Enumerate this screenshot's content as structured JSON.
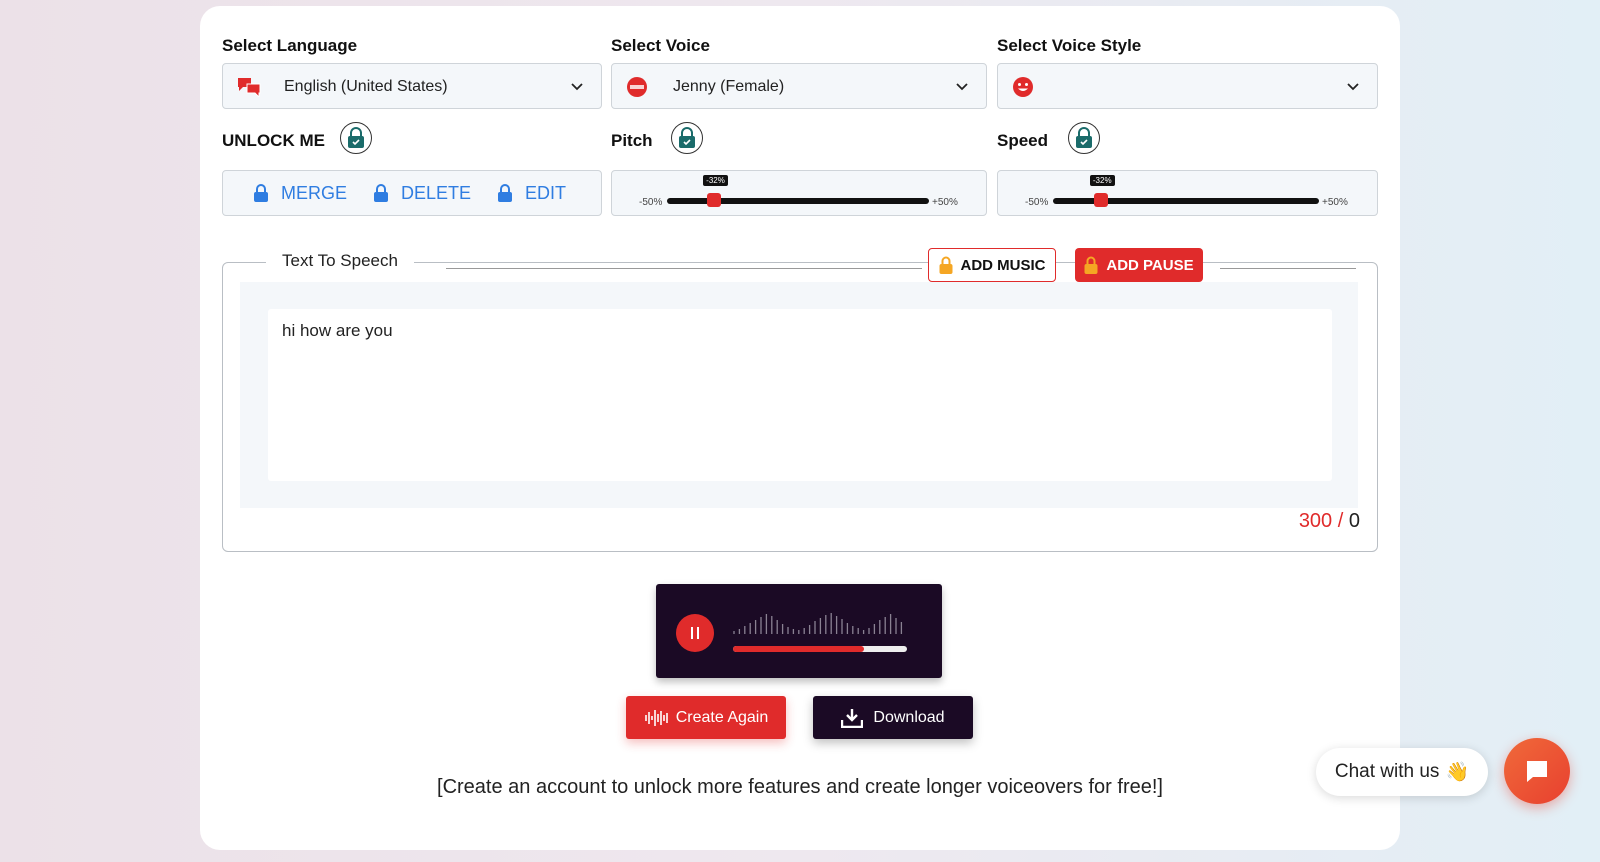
{
  "language": {
    "label": "Select Language",
    "value": "English (United States)"
  },
  "voice": {
    "label": "Select Voice",
    "value": "Jenny (Female)"
  },
  "voice_style": {
    "label": "Select Voice Style",
    "value": ""
  },
  "unlock": {
    "label": "UNLOCK ME",
    "actions": [
      "MERGE",
      "DELETE",
      "EDIT"
    ]
  },
  "pitch": {
    "label": "Pitch",
    "min_label": "-50%",
    "max_label": "+50%",
    "value_label": "-32%",
    "value_percent": -32
  },
  "speed": {
    "label": "Speed",
    "min_label": "-50%",
    "max_label": "+50%",
    "value_label": "-32%",
    "value_percent": -32
  },
  "tts": {
    "legend": "Text To Speech",
    "add_music": "ADD MUSIC",
    "add_pause": "ADD PAUSE",
    "text": "hi how are you",
    "limit": "300",
    "separator": "/",
    "count": "0"
  },
  "player": {
    "progress_fraction": 0.75
  },
  "buttons": {
    "create_again": "Create Again",
    "download": "Download"
  },
  "footer_note": "[Create an account to unlock more features and create longer voiceovers for free!]",
  "chat": {
    "label": "Chat with us",
    "emoji": "👋"
  },
  "colors": {
    "accent": "#e02b2b",
    "dark": "#1b0a25",
    "link": "#2f7de1"
  }
}
